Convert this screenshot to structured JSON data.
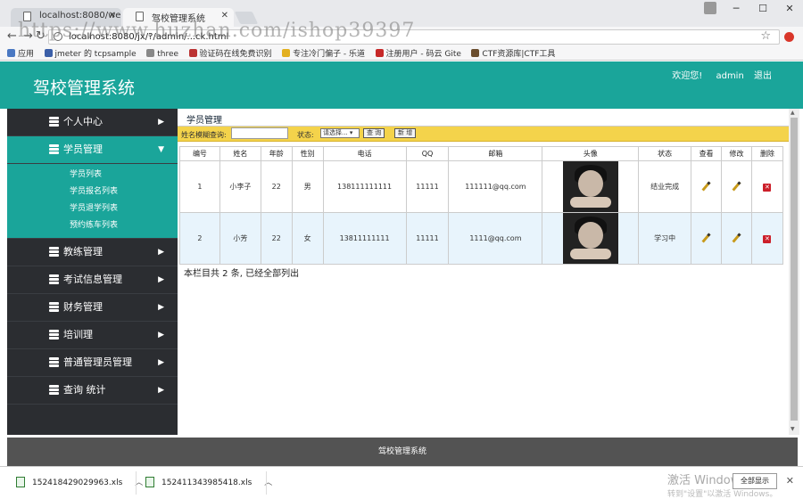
{
  "browser": {
    "tabs": [
      {
        "title": "localhost:8080/webto"
      },
      {
        "title": "驾校管理系统"
      }
    ],
    "url": "localhost:8080/jx/?/admin/...ck.html",
    "watermark": "https://www.huzhan.com/ishop39397",
    "bookmarks": [
      "应用",
      "jmeter 的 tcpsample",
      "three",
      "验证码在线免费识别",
      "专注冷门偏子 - 乐道",
      "注册用户 - 码云 Gite",
      "CTF资源库|CTF工具"
    ]
  },
  "header": {
    "title": "驾校管理系统",
    "welcome": "欢迎您!",
    "user": "admin",
    "logout": "退出"
  },
  "sidebar": {
    "items": [
      {
        "label": "个人中心",
        "arrow": "▶"
      },
      {
        "label": "学员管理",
        "arrow": "▼"
      },
      {
        "label": "教练管理",
        "arrow": "▶"
      },
      {
        "label": "考试信息管理",
        "arrow": "▶"
      },
      {
        "label": "财务管理",
        "arrow": "▶"
      },
      {
        "label": "培训理",
        "arrow": "▶"
      },
      {
        "label": "普通管理员管理",
        "arrow": "▶"
      },
      {
        "label": "查询 统计",
        "arrow": "▶"
      }
    ],
    "subitems": [
      "学员列表",
      "学员报名列表",
      "学员退学列表",
      "预约练车列表"
    ]
  },
  "main": {
    "title": "学员管理",
    "search_label": "姓名模糊查询:",
    "status_label": "状态:",
    "status_select": "请选择...",
    "query_button": "查 询",
    "add_button": "新 增",
    "columns": [
      "编号",
      "姓名",
      "年龄",
      "性别",
      "电话",
      "QQ",
      "邮箱",
      "头像",
      "状态",
      "查看",
      "修改",
      "删除"
    ],
    "rows": [
      {
        "id": "1",
        "name": "小李子",
        "age": "22",
        "gender": "男",
        "phone": "138111111111",
        "qq": "11111",
        "email": "111111@qq.com",
        "status": "结业完成"
      },
      {
        "id": "2",
        "name": "小芳",
        "age": "22",
        "gender": "女",
        "phone": "13811111111",
        "qq": "11111",
        "email": "1111@qq.com",
        "status": "学习中"
      }
    ],
    "summary": "本栏目共 2 条, 已经全部列出"
  },
  "footer": {
    "text": "驾校管理系统"
  },
  "downloads": {
    "files": [
      "152418429029963.xls",
      "152411343985418.xls"
    ],
    "show_all": "全部显示",
    "activate_windows": "激活 Windows",
    "activate_hint": "转到\"设置\"以激活 Windows。"
  },
  "colors": {
    "accent": "#1aa59a",
    "sidebar": "#2b2d31",
    "searchbar": "#f4d34b",
    "footer": "#535353"
  }
}
